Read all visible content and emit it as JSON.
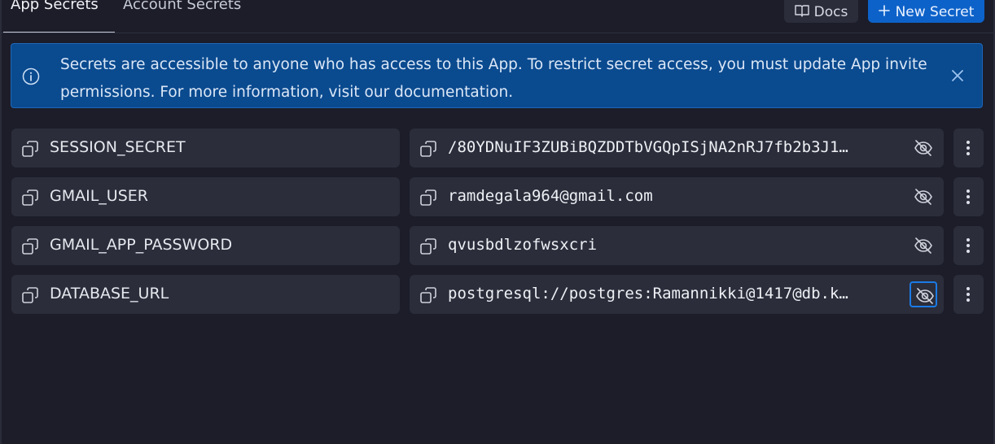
{
  "tabs": [
    {
      "label": "App Secrets",
      "active": true
    },
    {
      "label": "Account Secrets",
      "active": false
    }
  ],
  "toolbar": {
    "docs_label": "Docs",
    "docs_icon": "book-icon",
    "new_label": "New Secret",
    "new_icon": "plus-icon"
  },
  "banner": {
    "text": "Secrets are accessible to anyone who has access to this App. To restrict secret access, you must update App invite permissions. For more information, visit our documentation.",
    "icon": "info-icon",
    "close_icon": "close-icon"
  },
  "secrets": [
    {
      "key": "SESSION_SECRET",
      "value": "/80YDNuIF3ZUBiBQZDDTbVGQpISjNA2nRJ7fb2b3J1…"
    },
    {
      "key": "GMAIL_USER",
      "value": "ramdegala964@gmail.com"
    },
    {
      "key": "GMAIL_APP_PASSWORD",
      "value": "qvusbdlzofwsxcri"
    },
    {
      "key": "DATABASE_URL",
      "value": "postgresql://postgres:Ramannikki@1417@db.k…"
    }
  ],
  "colors": {
    "background": "#1c1d29",
    "surface": "#2b2d3b",
    "accent": "#0d62c9",
    "banner": "#0a4a8f",
    "focus": "#1a7be6"
  }
}
